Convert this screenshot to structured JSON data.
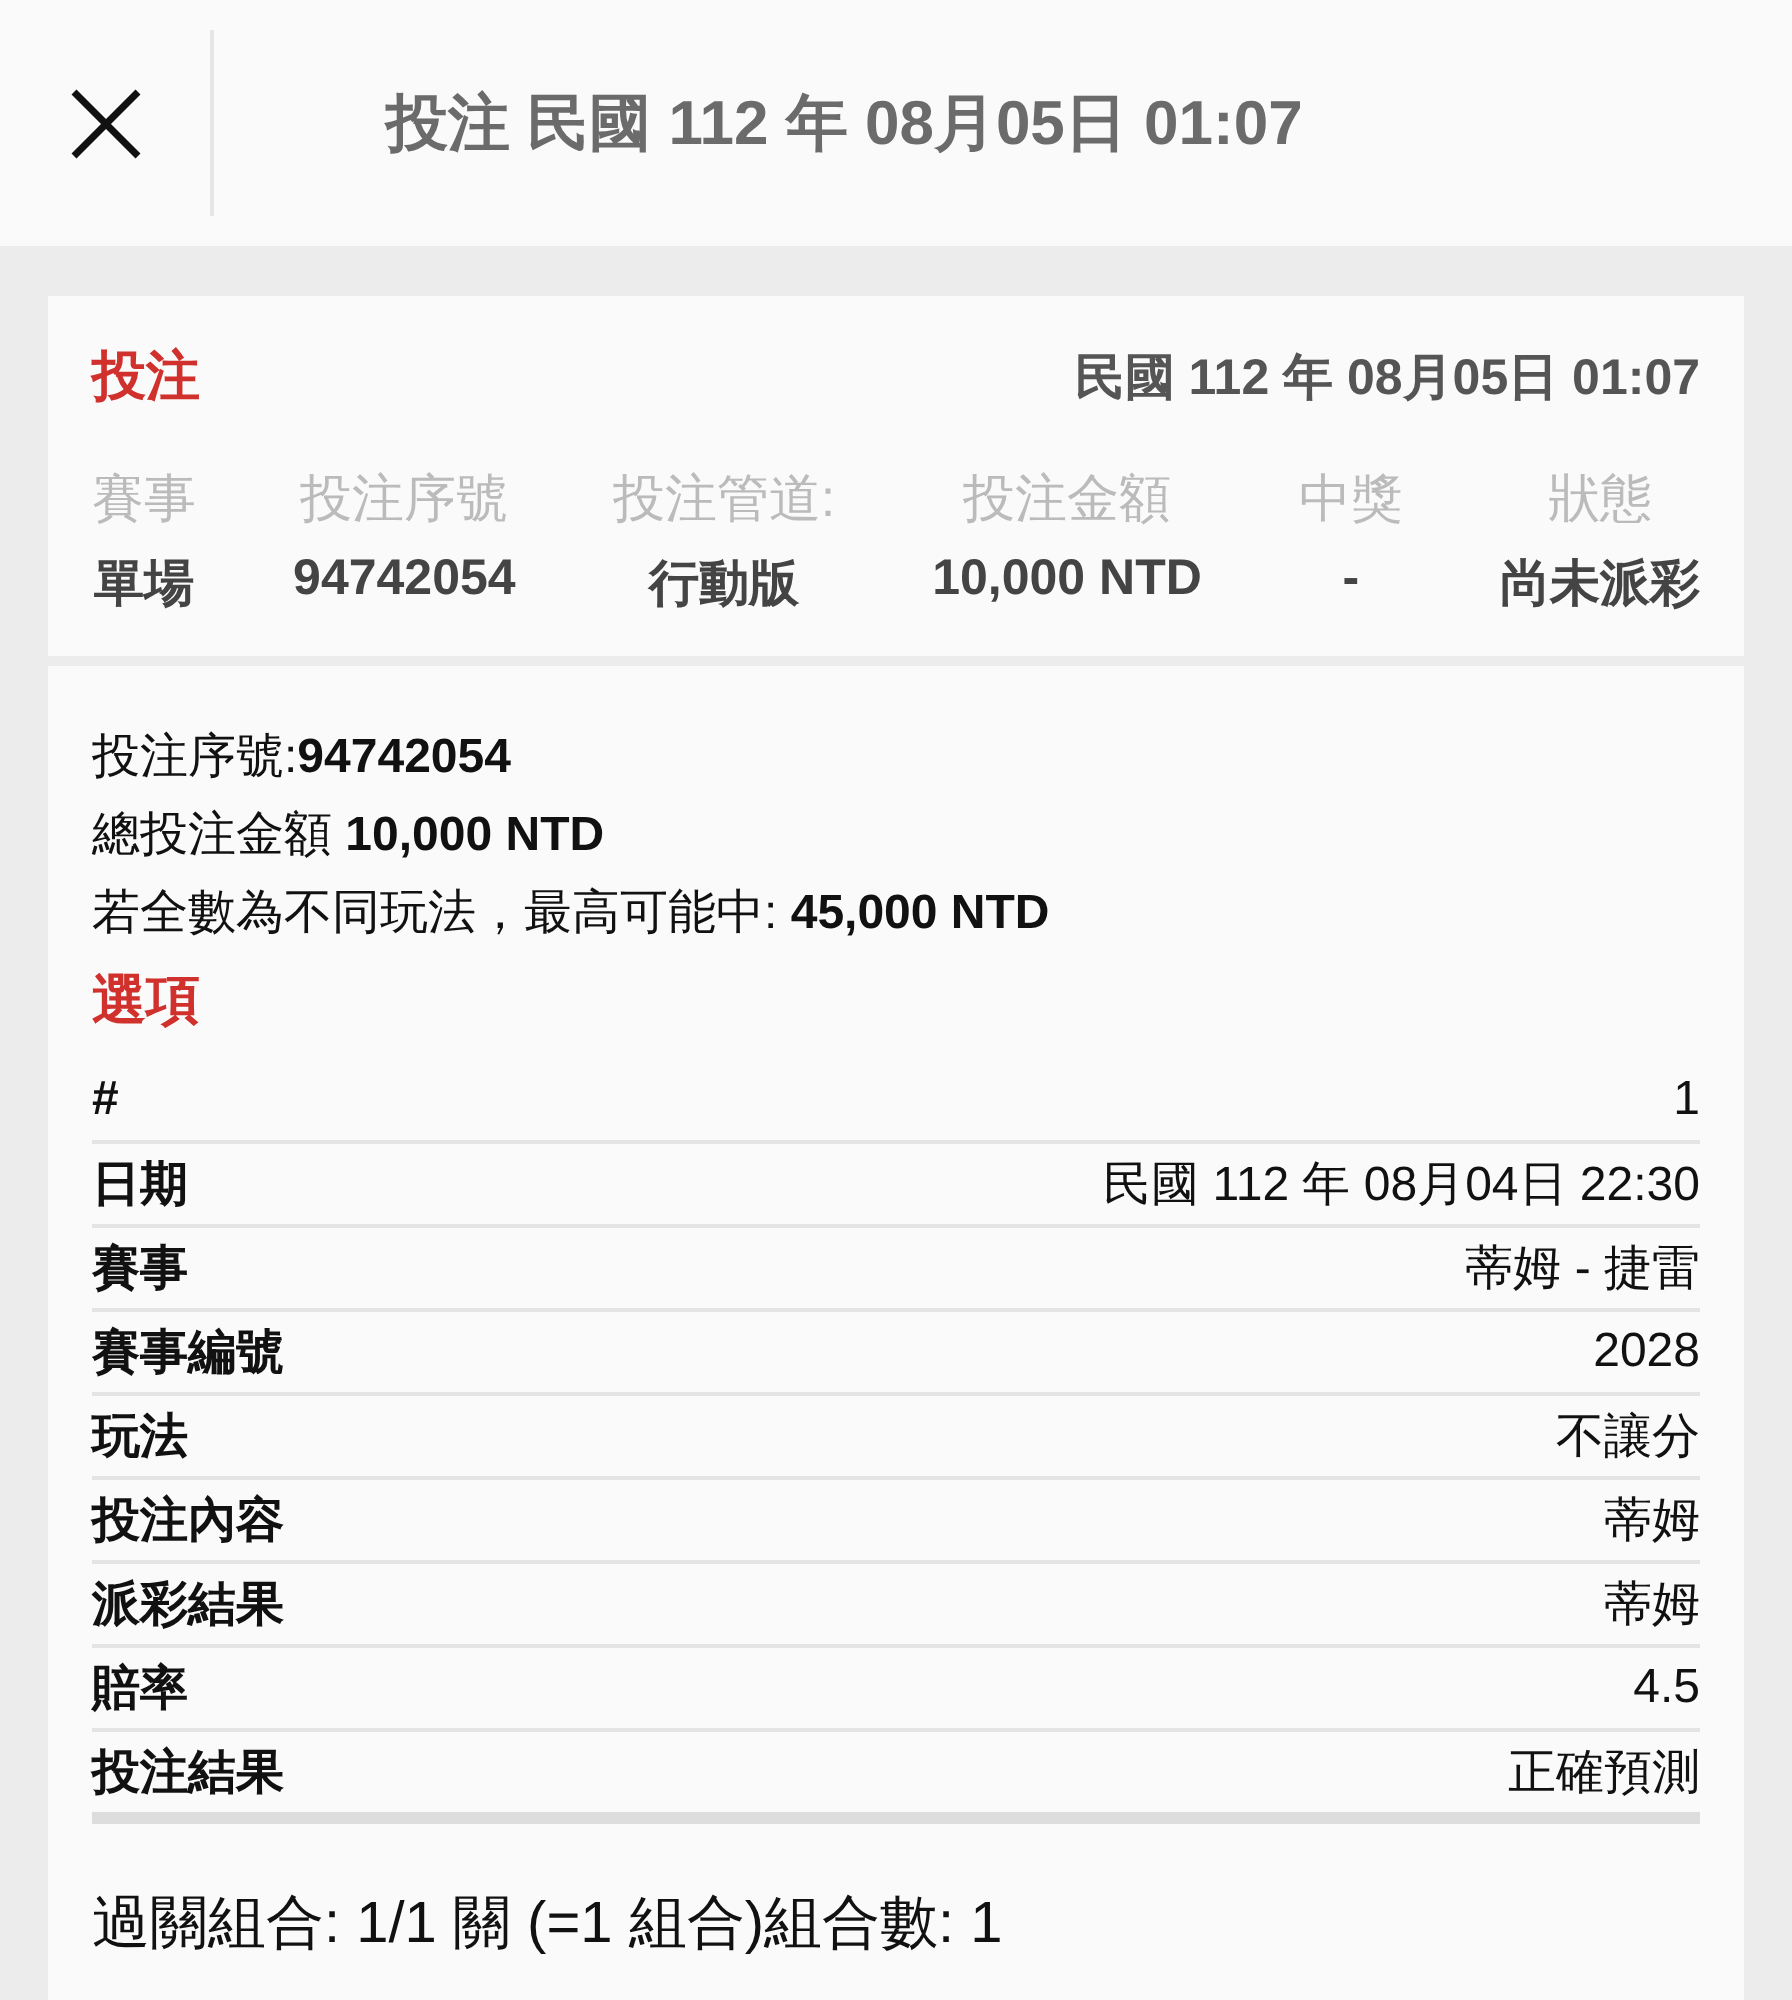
{
  "header": {
    "title": "投注 民國 112 年 08月05日 01:07"
  },
  "summary": {
    "heading": "投注",
    "datetime": "民國 112 年 08月05日 01:07",
    "columns": [
      {
        "label": "賽事",
        "value": "單場"
      },
      {
        "label": "投注序號",
        "value": "94742054"
      },
      {
        "label": "投注管道:",
        "value": "行動版"
      },
      {
        "label": "投注金額",
        "value": "10,000 NTD"
      },
      {
        "label": "中獎",
        "value": "-"
      },
      {
        "label": "狀態",
        "value": "尚未派彩"
      }
    ]
  },
  "details": {
    "lines": [
      "投注序號:**94742054**",
      "總投注金額 **10,000 NTD**",
      "若全數為不同玩法，最高可能中: **45,000 NTD**"
    ],
    "options_heading": "選項",
    "rows": [
      {
        "label": "#",
        "value": "1"
      },
      {
        "label": "日期",
        "value": "民國 112 年 08月04日 22:30"
      },
      {
        "label": "賽事",
        "value": "蒂姆 - 捷雷"
      },
      {
        "label": "賽事編號",
        "value": "2028"
      },
      {
        "label": "玩法",
        "value": "不讓分"
      },
      {
        "label": "投注內容",
        "value": "蒂姆"
      },
      {
        "label": "派彩結果",
        "value": "蒂姆"
      },
      {
        "label": "賠率",
        "value": "4.5"
      },
      {
        "label": "投注結果",
        "value": "正確預測"
      }
    ],
    "combination": "過關組合: 1/1 關 (=1 組合)組合數: 1"
  }
}
